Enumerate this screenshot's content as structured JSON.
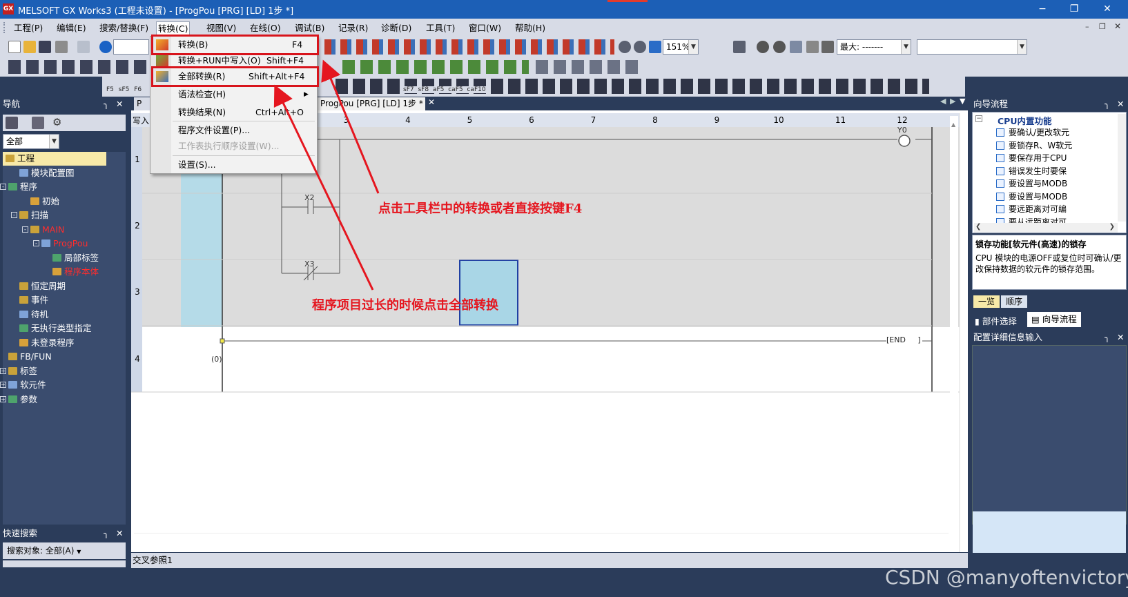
{
  "window": {
    "title": "MELSOFT GX Works3 (工程未设置) - [ProgPou [PRG] [LD] 1步 *]",
    "icon": "GX",
    "min": "−",
    "restore": "❐",
    "close": "✕"
  },
  "menubar": [
    "工程(P)",
    "编辑(E)",
    "搜索/替换(F)",
    "转换(C)",
    "视图(V)",
    "在线(O)",
    "调试(B)",
    "记录(R)",
    "诊断(D)",
    "工具(T)",
    "窗口(W)",
    "帮助(H)"
  ],
  "toolbar": {
    "zoom": "151%",
    "filter_value": "最大: -------",
    "fkeys": [
      "F5",
      "sF5",
      "F6",
      "sF7",
      "sF8",
      "aF5",
      "caF5",
      "caF10"
    ]
  },
  "convert_menu": [
    {
      "label": "转换(B)",
      "shortcut": "F4",
      "icon": "convert-icon",
      "enabled": true
    },
    {
      "label": "转换+RUN中写入(O)",
      "shortcut": "Shift+F4",
      "icon": "convert-run-write-icon",
      "enabled": true
    },
    {
      "label": "全部转换(R)",
      "shortcut": "Shift+Alt+F4",
      "icon": "convert-all-icon",
      "enabled": true
    },
    {
      "label": "语法检查(H)",
      "shortcut": "",
      "submenu": true,
      "enabled": true
    },
    {
      "label": "转换结果(N)",
      "shortcut": "Ctrl+Alt+O",
      "enabled": true
    },
    {
      "label": "程序文件设置(P)...",
      "shortcut": "",
      "enabled": true
    },
    {
      "label": "工作表执行顺序设置(W)...",
      "shortcut": "",
      "enabled": false
    },
    {
      "label": "设置(S)...",
      "shortcut": "",
      "enabled": true
    }
  ],
  "nav": {
    "title": "导航",
    "filter": "全部",
    "tree": [
      {
        "label": "工程",
        "level": 0,
        "selected": true
      },
      {
        "label": "模块配置图",
        "level": 1
      },
      {
        "label": "程序",
        "level": 0,
        "expand": "-"
      },
      {
        "label": "初始",
        "level": 2
      },
      {
        "label": "扫描",
        "level": 1,
        "expand": "-"
      },
      {
        "label": "MAIN",
        "level": 2,
        "expand": "-",
        "red": true
      },
      {
        "label": "ProgPou",
        "level": 3,
        "expand": "-",
        "red": true
      },
      {
        "label": "局部标签",
        "level": 4
      },
      {
        "label": "程序本体",
        "level": 4,
        "red": true
      },
      {
        "label": "恒定周期",
        "level": 1
      },
      {
        "label": "事件",
        "level": 1
      },
      {
        "label": "待机",
        "level": 1
      },
      {
        "label": "无执行类型指定",
        "level": 1
      },
      {
        "label": "未登录程序",
        "level": 1
      },
      {
        "label": "FB/FUN",
        "level": 0
      },
      {
        "label": "标签",
        "level": 0,
        "expand": "+"
      },
      {
        "label": "软元件",
        "level": 0,
        "expand": "+"
      },
      {
        "label": "参数",
        "level": 0,
        "expand": "+"
      }
    ]
  },
  "quick_search": {
    "title": "快速搜索",
    "target": "搜索对象: 全部(A)"
  },
  "editor": {
    "tabs": [
      "P",
      "ProgPou [PRG] [LD] 1步 *"
    ],
    "write_label": "写入",
    "columns": [
      "1",
      "2",
      "3",
      "4",
      "5",
      "6",
      "7",
      "8",
      "9",
      "10",
      "11",
      "12"
    ],
    "rows": [
      "1",
      "2",
      "3",
      "4"
    ],
    "contacts": [
      "X2",
      "X3"
    ],
    "coil": "Y0",
    "step": "(0)",
    "end": "END"
  },
  "crossref": "交叉参照1",
  "annotations": {
    "a1": "点击工具栏中的转换或者直接按键F4",
    "a2": "程序项目过长的时候点击全部转换"
  },
  "wizard": {
    "title": "向导流程",
    "group": "CPU内置功能",
    "items": [
      "要确认/更改软元",
      "要锁存R、W软元",
      "要保存用于CPU",
      "错误发生时要保",
      "要设置与MODB",
      "要设置与MODB",
      "要远距离对可编",
      "要从远距离对可"
    ],
    "desc_title": "锁存功能[软元件(高速)的锁存",
    "desc": "CPU 模块的电源OFF或复位时可确认/更改保持数据的软元件的锁存范围。",
    "tab_list": "一览",
    "tab_order": "顺序",
    "bottom_tabs": [
      "部件选择",
      "向导流程"
    ]
  },
  "detail": {
    "title": "配置详细信息输入"
  },
  "watermark": "CSDN @manyoftenvictory",
  "colors": {
    "accent": "#1c5fb6",
    "annotation": "#e5161f",
    "panel": "#2b3c5a"
  }
}
